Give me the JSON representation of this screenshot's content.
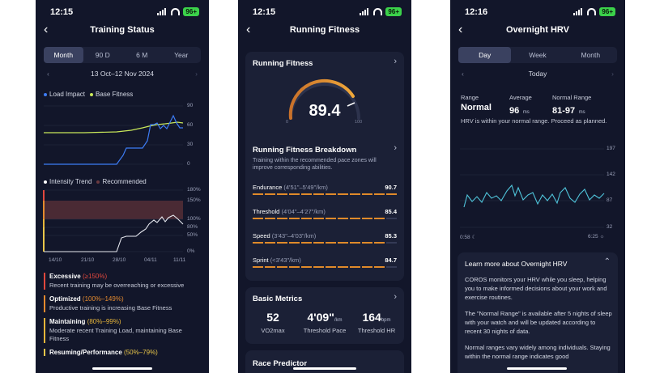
{
  "status": {
    "p1_time": "12:15",
    "p2_time": "12:15",
    "p3_time": "12:16",
    "battery": "96+"
  },
  "training_status": {
    "title": "Training Status",
    "tabs": [
      "Month",
      "90 D",
      "6 M",
      "Year"
    ],
    "date_range": "13 Oct–12 Nov 2024",
    "legend": {
      "load": "Load Impact",
      "base": "Base Fitness"
    },
    "top_y_ticks": [
      "90",
      "60",
      "30",
      "0"
    ],
    "intensity_legend": {
      "trend": "Intensity Trend",
      "recommended": "Recommended"
    },
    "intensity_y_ticks": [
      "180%",
      "150%",
      "100%",
      "80%",
      "50%",
      "0%"
    ],
    "x_ticks": [
      "14/10",
      "21/10",
      "28/10",
      "04/11",
      "11/11"
    ],
    "zones": [
      {
        "title": "Excessive",
        "range": "(≥150%)",
        "desc": "Recent training may be overreaching or excessive",
        "color": "#e2483d"
      },
      {
        "title": "Optimized",
        "range": "(100%–149%)",
        "desc": "Productive training is increasing Base Fitness",
        "color": "#e48a2e"
      },
      {
        "title": "Maintaining",
        "range": "(80%–99%)",
        "desc": "Moderate recent Training Load, maintaining Base Fitness",
        "color": "#e6b53a"
      },
      {
        "title": "Resuming/Performance",
        "range": "(50%–79%)",
        "desc": "",
        "color": "#e9c64a"
      }
    ]
  },
  "running_fitness": {
    "title": "Running Fitness",
    "card_title": "Running Fitness",
    "score": "89.4",
    "gauge_min": "0",
    "gauge_max": "100",
    "breakdown_title": "Running Fitness Breakdown",
    "breakdown_desc": "Training within the recommended pace zones will improve corresponding abilities.",
    "rows": [
      {
        "label": "Endurance",
        "pace": "(4'51\"–5'49\"/km)",
        "value": "90.7"
      },
      {
        "label": "Threshold",
        "pace": "(4'04\"–4'27\"/km)",
        "value": "85.4"
      },
      {
        "label": "Speed",
        "pace": "(3'43\"–4'03\"/km)",
        "value": "85.3"
      },
      {
        "label": "Sprint",
        "pace": "(<3'43\"/km)",
        "value": "84.7"
      }
    ],
    "basic_metrics_title": "Basic Metrics",
    "metrics": [
      {
        "value": "52",
        "unit": "",
        "label": "VO2max"
      },
      {
        "value": "4'09\"",
        "unit": "/km",
        "label": "Threshold Pace"
      },
      {
        "value": "164",
        "unit": "bpm",
        "label": "Threshold HR"
      }
    ],
    "race_predictor_title": "Race Predictor"
  },
  "overnight_hrv": {
    "title": "Overnight HRV",
    "tabs": [
      "Day",
      "Week",
      "Month"
    ],
    "day_label": "Today",
    "range_label": "Range",
    "range_value": "Normal",
    "average_label": "Average",
    "average_value": "96",
    "average_unit": "ms",
    "normal_label": "Normal Range",
    "normal_value": "81-97",
    "normal_unit": "ms",
    "message": "HRV is within your normal range. Proceed as planned.",
    "y_ticks": [
      "197",
      "142",
      "87",
      "32"
    ],
    "x_start": "0:58",
    "x_end": "6:25",
    "learn_title": "Learn more about Overnight HRV",
    "para1": "COROS monitors your HRV while you sleep, helping you to make informed decisions about your work and exercise routines.",
    "para2": "The \"Normal Range\" is available after 5 nights of sleep with your watch and will be updated according to recent 30 nights of data.",
    "para3": "Normal ranges vary widely among individuals. Staying within the normal range indicates good"
  }
}
